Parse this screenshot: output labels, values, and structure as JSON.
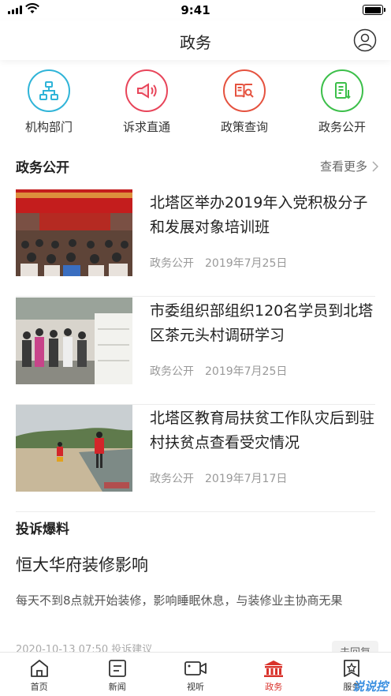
{
  "status_bar": {
    "time": "9:41"
  },
  "header": {
    "title": "政务"
  },
  "quick_links": [
    {
      "label": "机构部门",
      "icon": "org-chart-icon",
      "color": "#2fb4d8"
    },
    {
      "label": "诉求直通",
      "icon": "megaphone-icon",
      "color": "#e8455a"
    },
    {
      "label": "政策查询",
      "icon": "book-search-icon",
      "color": "#e5523f"
    },
    {
      "label": "政务公开",
      "icon": "document-icon",
      "color": "#3cbf4a"
    }
  ],
  "gov_section": {
    "title": "政务公开",
    "more": "查看更多"
  },
  "news": [
    {
      "title": "北塔区举办2019年入党积极分子和发展对象培训班",
      "source": "政务公开",
      "date": "2019年7月25日"
    },
    {
      "title": "市委组织部组织120名学员到北塔区茶元头村调研学习",
      "source": "政务公开",
      "date": "2019年7月25日"
    },
    {
      "title": "北塔区教育局扶贫工作队灾后到驻村扶贫点查看受灾情况",
      "source": "政务公开",
      "date": "2019年7月17日"
    }
  ],
  "complaint_section": {
    "title": "投诉爆料"
  },
  "complaint": {
    "title": "恒大华府装修影响",
    "body": "每天不到8点就开始装修，影响睡眠休息，与装修业主协商无果",
    "meta": "2020-10-13 07:50   投诉建议",
    "status": "未回复"
  },
  "tabs": [
    {
      "label": "首页",
      "icon": "home-icon"
    },
    {
      "label": "新闻",
      "icon": "news-icon"
    },
    {
      "label": "视听",
      "icon": "video-camera-icon"
    },
    {
      "label": "政务",
      "icon": "government-building-icon",
      "active": true
    },
    {
      "label": "服务",
      "icon": "service-badge-icon"
    }
  ],
  "watermark": "说说控",
  "colors": {
    "accent": "#d9322b",
    "text": "#222222",
    "muted": "#999999"
  }
}
